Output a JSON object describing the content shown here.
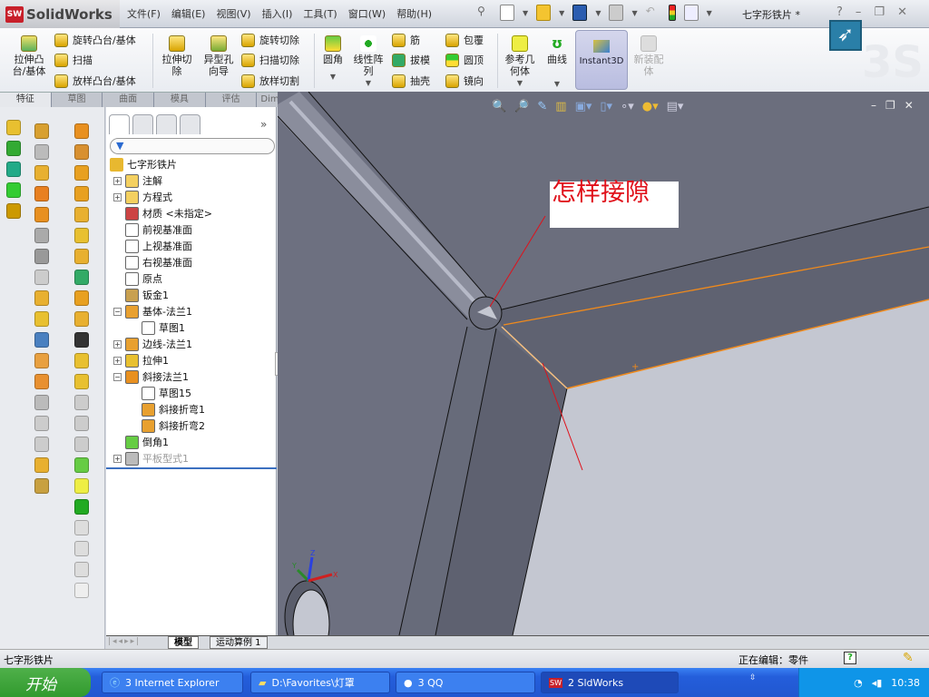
{
  "app": {
    "name": "SolidWorks",
    "logo_badge": "SW",
    "doc_title": "七字形铁片 *"
  },
  "menu": [
    "文件(F)",
    "编辑(E)",
    "视图(V)",
    "插入(I)",
    "工具(T)",
    "窗口(W)",
    "帮助(H)"
  ],
  "window_controls": {
    "help": "?",
    "minimize": "–",
    "restore": "❐",
    "close": "✕"
  },
  "ribbon": {
    "extrude_boss": "拉伸凸台/基体",
    "revolve_boss": "旋转凸台/基体",
    "sweep": "扫描",
    "loft_boss": "放样凸台/基体",
    "extrude_cut": "拉伸切除",
    "hole_wizard": "异型孔向导",
    "revolve_cut": "旋转切除",
    "sweep_cut": "扫描切除",
    "loft_cut": "放样切割",
    "fillet": "圆角",
    "linear_pattern": "线性阵列",
    "rib": "筋",
    "draft": "拔模",
    "shell": "抽壳",
    "wrap": "包覆",
    "dome": "圆顶",
    "mirror": "镜向",
    "ref_geometry": "参考几何体",
    "curves": "曲线",
    "instant3d": "Instant3D",
    "new_assembly": "新装配体"
  },
  "command_tabs": [
    "特征",
    "草图",
    "曲面",
    "模具",
    "评估",
    "DimXpert"
  ],
  "tree": {
    "root": "七字形铁片",
    "items": [
      "注解",
      "方程式",
      "材质 <未指定>",
      "前视基准面",
      "上视基准面",
      "右视基准面",
      "原点",
      "钣金1",
      "基体-法兰1",
      "草图1",
      "边线-法兰1",
      "拉伸1",
      "斜接法兰1",
      "草图15",
      "斜接折弯1",
      "斜接折弯2",
      "倒角1",
      "平板型式1"
    ],
    "more": "»",
    "filter_icon": "funnel-icon"
  },
  "annotation": {
    "text": "怎样接隙",
    "color": "#e0101a"
  },
  "triad": {
    "x": "X",
    "y": "Y",
    "z": "Z"
  },
  "bottom_tabs": {
    "model": "模型",
    "motion": "运动算例 1"
  },
  "status": {
    "doc": "七字形铁片",
    "editing": "正在编辑：零件"
  },
  "taskbar": {
    "start": "开始",
    "tasks": [
      "3 Internet Explorer",
      "D:\\Favorites\\灯罩",
      "3 QQ",
      "2 SldWorks"
    ],
    "clock": "10:38"
  },
  "colors": {
    "viewport": "#6c6f7e",
    "light_face": "#c4c7d1",
    "selected_edge": "#f08a1c",
    "taskbar": "#245edb"
  }
}
